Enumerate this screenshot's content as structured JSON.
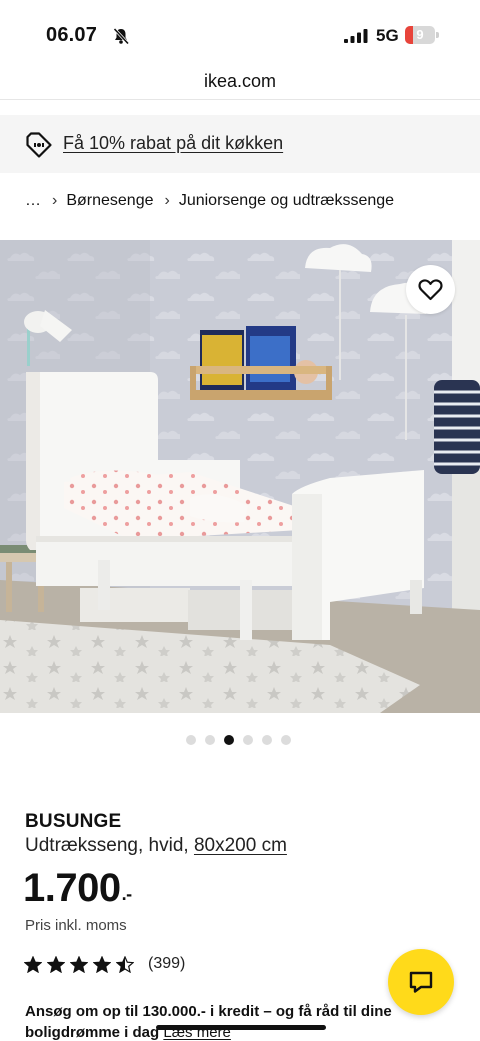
{
  "status_bar": {
    "time": "06.07",
    "network": "5G",
    "battery_level": "9",
    "icons": [
      "bell-slash-icon",
      "signal-bars-icon",
      "battery-icon"
    ]
  },
  "browser": {
    "domain": "ikea.com"
  },
  "promo": {
    "text": "Få 10% rabat på dit køkken",
    "icon": "price-tag-icon"
  },
  "breadcrumb": {
    "items": [
      "…",
      "Børnesenge",
      "Juniorsenge og udtrækssenge"
    ],
    "separator": "›"
  },
  "gallery": {
    "image": "white extendable junior bed in a children's room with cloud wallpaper",
    "total_images": 6,
    "active_index": 2,
    "favourite_icon": "heart-icon"
  },
  "product": {
    "name": "BUSUNGE",
    "description": "Udtræksseng, hvid,",
    "size": "80x200 cm",
    "price": "1.700",
    "price_suffix": ".-",
    "vat_note": "Pris inkl. moms",
    "rating": 4.5,
    "review_count": "(399)"
  },
  "credit": {
    "text": "Ansøg om op til 130.000.- i kredit – og få råd til dine boligdrømme i dag",
    "link_label": "Læs mere"
  },
  "chat": {
    "icon": "chat-bubble-icon"
  },
  "colors": {
    "accent_yellow": "#ffda1a",
    "battery_low": "#e8443b",
    "promo_bg": "#f5f5f5"
  }
}
